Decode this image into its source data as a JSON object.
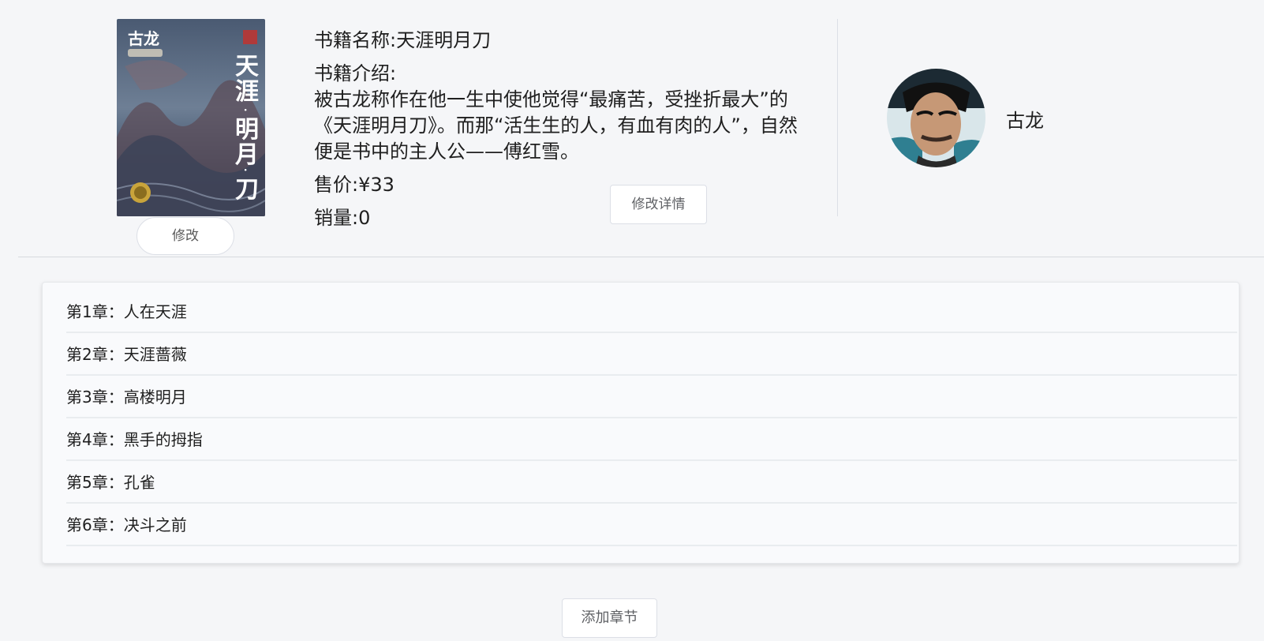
{
  "book": {
    "cover_alt": "天涯·明月·刀 封面",
    "title_label": "书籍名称:天涯明月刀",
    "intro_label": "书籍介绍:",
    "intro_text": "被古龙称作在他一生中使他觉得“最痛苦，受挫折最大”的《天涯明月刀》。而那“活生生的人，有血有肉的人”，自然便是书中的主人公——傅红雪。",
    "price_label": "售价:¥33",
    "sales_label": "销量:0"
  },
  "cover_actions": {
    "edit_label": "修改"
  },
  "detail_actions": {
    "edit_detail_label": "修改详情"
  },
  "author": {
    "name": "古龙"
  },
  "chapters": [
    {
      "label": "第1章：人在天涯"
    },
    {
      "label": "第2章：天涯蔷薇"
    },
    {
      "label": "第3章：高楼明月"
    },
    {
      "label": "第4章：黑手的拇指"
    },
    {
      "label": "第5章：孔雀"
    },
    {
      "label": "第6章：决斗之前"
    }
  ],
  "footer": {
    "add_chapter_label": "添加章节"
  },
  "colors": {
    "page_bg": "#f5f6f8",
    "border": "#dcdfe6",
    "text": "#1f1f1f",
    "button_text": "#606266"
  },
  "icons": {
    "cover": "book-cover-image",
    "avatar": "author-avatar-image"
  }
}
